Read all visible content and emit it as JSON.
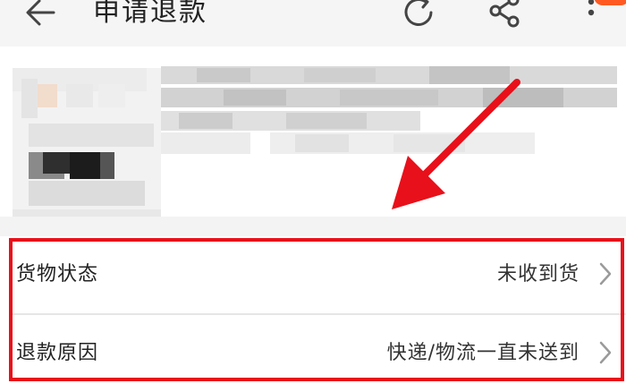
{
  "header": {
    "title": "申请退款",
    "back_icon": "arrow-left-icon",
    "actions": [
      "refresh-icon",
      "share-icon",
      "more-vertical-icon"
    ],
    "badge_color": "#ff5a22"
  },
  "product": {
    "obscured": true
  },
  "form": {
    "rows": [
      {
        "label": "货物状态",
        "value": "未收到货"
      },
      {
        "label": "退款原因",
        "value": "快递/物流一直未送到"
      }
    ]
  },
  "annotation": {
    "color": "#e8101a"
  }
}
